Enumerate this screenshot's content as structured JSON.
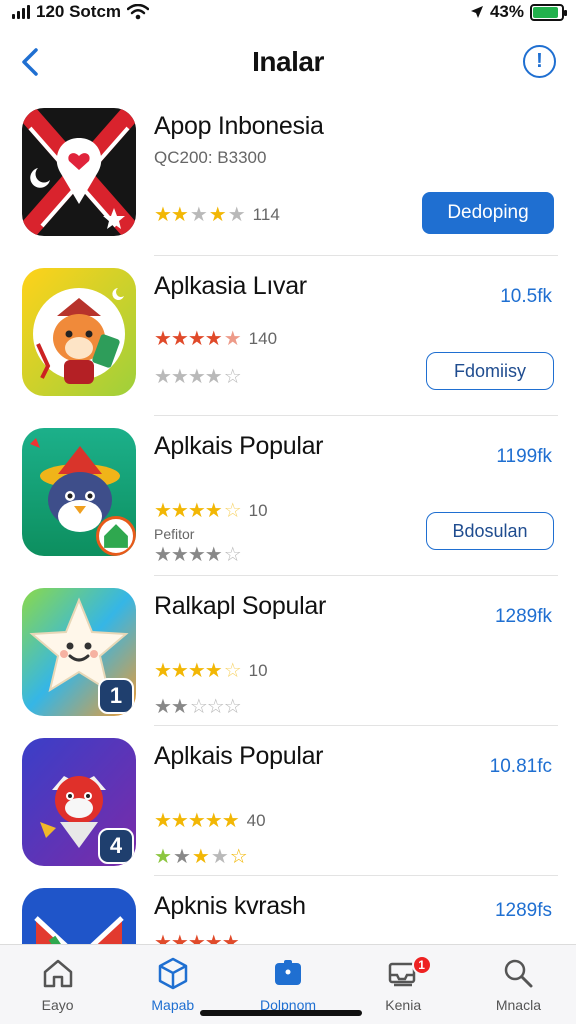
{
  "status_bar": {
    "time": "120 Sotcm",
    "battery_text": "43%",
    "battery_level": 0.9,
    "battery_color": "#22b14c"
  },
  "nav": {
    "title": "Inalar",
    "back_icon": "chevron-left-icon",
    "info_icon": "info-icon",
    "info_glyph": "!"
  },
  "accent": "#1f6fd1",
  "apps": [
    {
      "name": "Apop Inbonesia",
      "subtitle": "QC200: B3300",
      "rating_count": "114",
      "button": "Dedoping",
      "button_style": "filled"
    },
    {
      "name": "Aplkasia Lıvar",
      "size": "10.5fk",
      "rating_count": "140",
      "button": "Fdomiisy",
      "button_style": "outline"
    },
    {
      "name": "Aplkais Popular",
      "size": "1199fk",
      "subtitle": "Pefitor",
      "rating_count": "10",
      "button": "Bdosulan",
      "button_style": "outline"
    },
    {
      "name": "Ralkapl Sopular",
      "size": "1289fk",
      "rating_count": "10",
      "badge": "1"
    },
    {
      "name": "Aplkais Popular",
      "size": "10.81fc",
      "rating_count": "40",
      "badge": "4"
    },
    {
      "name": "Apknis kvrash",
      "size": "1289fs"
    }
  ],
  "tabs": [
    {
      "label": "Eayo",
      "icon": "home-icon"
    },
    {
      "label": "Mapab",
      "icon": "cube-icon"
    },
    {
      "label": "Dolpnom",
      "icon": "folder-icon"
    },
    {
      "label": "Kenia",
      "icon": "inbox-icon",
      "badge": "1"
    },
    {
      "label": "Mnacla",
      "icon": "search-icon"
    }
  ]
}
